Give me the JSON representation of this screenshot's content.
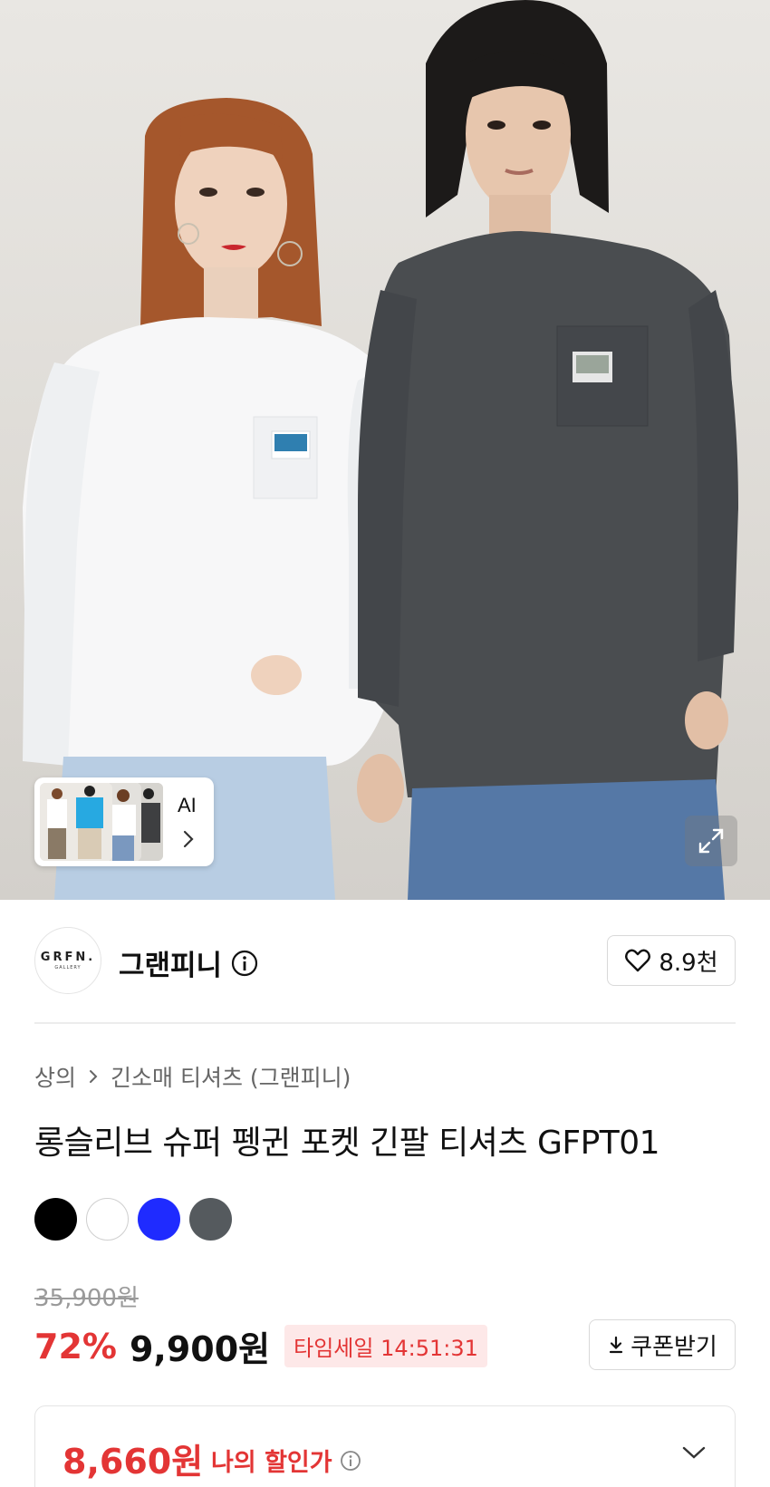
{
  "hero": {
    "ai_label": "AI"
  },
  "brand": {
    "logo_line1": "GRFN.",
    "logo_line2": "GALLERY",
    "name": "그랜피니",
    "likes": "8.9천"
  },
  "breadcrumb": {
    "category": "상의",
    "subcategory": "긴소매 티셔츠 (그랜피니)"
  },
  "product": {
    "title": "롱슬리브 슈퍼 펭귄 포켓 긴팔 티셔츠 GFPT01",
    "colors": [
      "#000000",
      "#ffffff",
      "#1f2bff",
      "#555a5e"
    ],
    "original_price": "35,900원",
    "discount": "72%",
    "sale_price": "9,900원",
    "timesale": "타임세일 14:51:31",
    "coupon_label": "쿠폰받기"
  },
  "my_deal": {
    "price": "8,660원",
    "label": "나의 할인가"
  }
}
